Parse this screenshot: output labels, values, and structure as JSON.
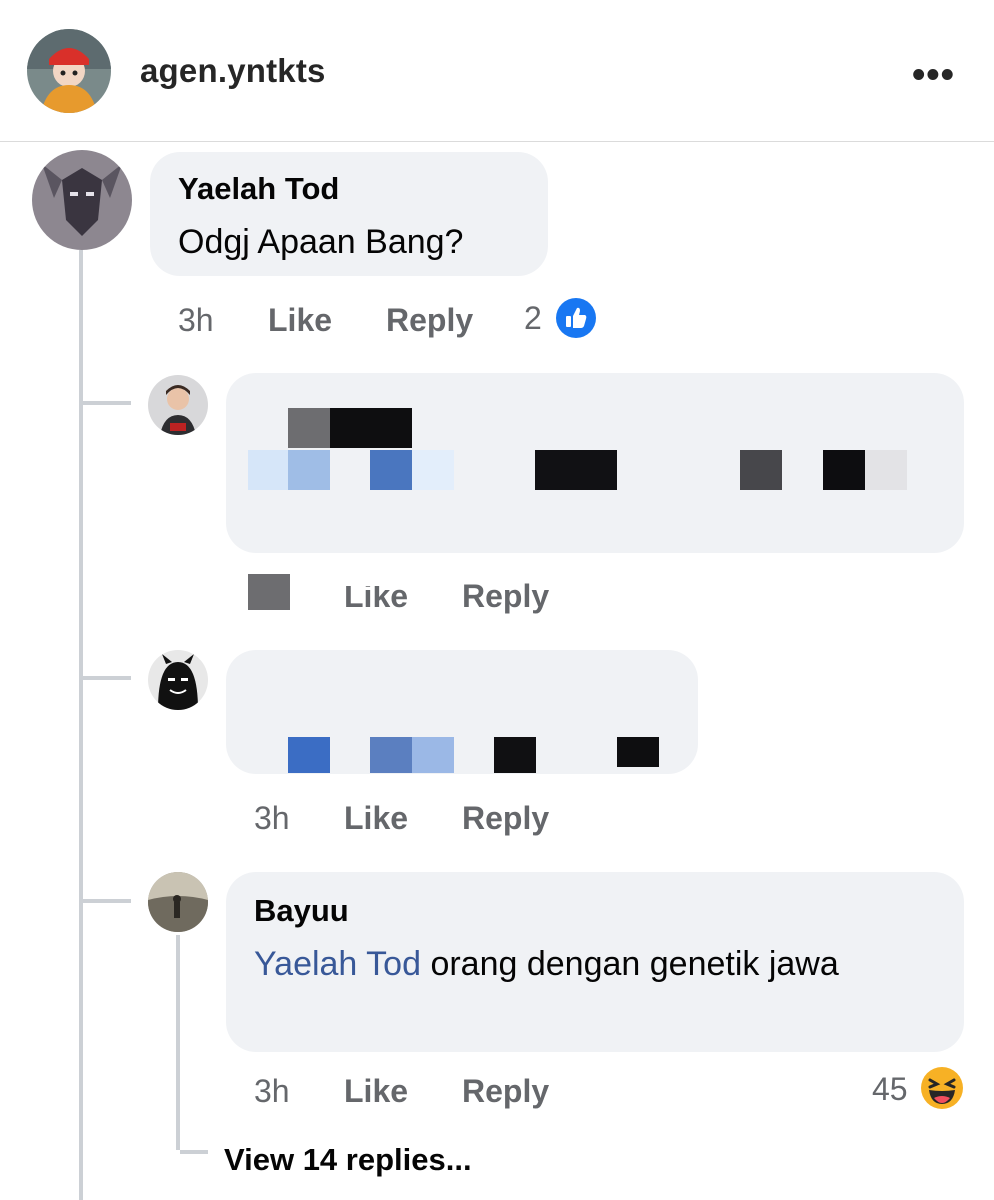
{
  "header": {
    "username": "agen.yntkts",
    "more_label": "•••"
  },
  "comments": [
    {
      "author": "Yaelah Tod",
      "text": "Odgj Apaan Bang?",
      "time": "3h",
      "like_label": "Like",
      "reply_label": "Reply",
      "reaction_count": "2",
      "reaction_icon": "thumbs-up-icon"
    },
    {
      "author": "",
      "text": "",
      "time": "",
      "like_label": "Like",
      "reply_label": "Reply",
      "censored": true
    },
    {
      "author": "",
      "text": "",
      "time": "3h",
      "like_label": "Like",
      "reply_label": "Reply",
      "censored": true
    },
    {
      "author": "Bayuu",
      "mention": "Yaelah Tod",
      "text": " orang dengan genetik jawa",
      "time": "3h",
      "like_label": "Like",
      "reply_label": "Reply",
      "reaction_count": "45",
      "reaction_icon": "laughing-emoji-icon"
    }
  ],
  "view_replies_label": "View 14 replies...",
  "colors": {
    "bubble": "#f0f2f5",
    "meta_text": "#65676b",
    "mention": "#385898",
    "like_blue": "#1877f2",
    "thread_line": "#ccd0d5"
  }
}
